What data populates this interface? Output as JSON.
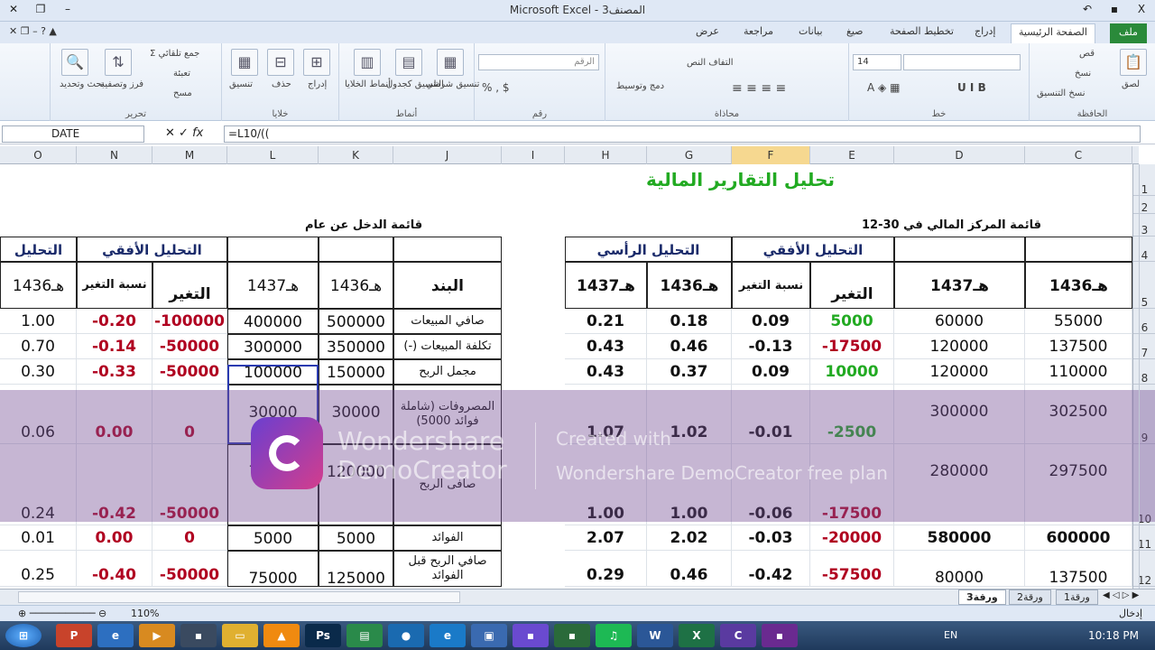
{
  "window": {
    "title": "Microsoft Excel - المصنف3"
  },
  "tabs": [
    "ملف",
    "الصفحة الرئيسية",
    "إدراج",
    "تخطيط الصفحة",
    "صيغ",
    "بيانات",
    "مراجعة",
    "عرض"
  ],
  "ribbon": {
    "clipboard": {
      "group": "الحافظة",
      "paste": "لصق",
      "cut": "قص",
      "copy": "نسخ",
      "format_painter": "نسخ التنسيق"
    },
    "font": {
      "group": "خط",
      "size": "14"
    },
    "alignment": {
      "group": "محاذاة",
      "wrap": "التفاف النص",
      "merge": "دمج وتوسيط"
    },
    "number": {
      "group": "رقم",
      "format": "الرقم"
    },
    "styles": {
      "group": "أنماط",
      "cond": "تنسيق شرطي",
      "table": "التنسيق كجدول",
      "cell": "أنماط الخلايا"
    },
    "cells": {
      "group": "خلايا",
      "insert": "إدراج",
      "delete": "حذف",
      "format": "تنسيق"
    },
    "editing": {
      "group": "تحرير",
      "autosum": "جمع تلقائي",
      "fill": "تعبئة",
      "clear": "مسح",
      "sort": "فرز وتصفية",
      "find": "بحث وتحديد"
    }
  },
  "formula_bar": {
    "name_box": "DATE",
    "formula": "=L10/(("
  },
  "columns": [
    "O",
    "N",
    "M",
    "L",
    "K",
    "J",
    "I",
    "H",
    "G",
    "F",
    "E",
    "D",
    "C"
  ],
  "rows": [
    "1",
    "2",
    "3",
    "4",
    "5",
    "6",
    "7",
    "8",
    "9",
    "10",
    "11",
    "12"
  ],
  "sheet": {
    "title": "تحليل التقارير المالية",
    "left_heading": "قائمة الدخل عن عام",
    "right_heading": "قائمة المركز المالي في 30-12",
    "horiz": "التحليل الأفقي",
    "vert": "التحليل الرأسي",
    "tahlil": "التحليل",
    "change": "التغير",
    "pct_change": "نسبة التغير",
    "y1436": "1436هـ",
    "y1437": "1437هـ",
    "item": "البند",
    "items": [
      "صافي المبيعات",
      "(-) تكلفة المبيعات",
      "مجمل الربح",
      "المصروفات (شاملة فوائد 5000)",
      "صافى الربح",
      "الفوائد",
      "صافي الربح قبل الفوائد"
    ],
    "O": [
      "1.00",
      "0.70",
      "0.30",
      "0.06",
      "0.24",
      "0.01",
      "0.25"
    ],
    "N": [
      "-0.20",
      "-0.14",
      "-0.33",
      "0.00",
      "-0.42",
      "0.00",
      "-0.40"
    ],
    "M": [
      "-100000",
      "-50000",
      "-50000",
      "0",
      "-50000",
      "0",
      "-50000"
    ],
    "L": [
      "400000",
      "300000",
      "100000",
      "30000",
      "70000",
      "5000",
      "75000"
    ],
    "K": [
      "500000",
      "350000",
      "150000",
      "30000",
      "120000",
      "5000",
      "125000"
    ],
    "H": [
      "0.21",
      "0.43",
      "0.43",
      "1.07",
      "1.00",
      "2.07",
      "0.29"
    ],
    "G": [
      "0.18",
      "0.46",
      "0.37",
      "1.02",
      "1.00",
      "2.02",
      "0.46"
    ],
    "F": [
      "0.09",
      "-0.13",
      "0.09",
      "-0.01",
      "-0.06",
      "-0.03",
      "-0.42"
    ],
    "E": [
      "5000",
      "-17500",
      "10000",
      "-2500",
      "-17500",
      "-20000",
      "-57500"
    ],
    "D": [
      "60000",
      "120000",
      "120000",
      "300000",
      "280000",
      "580000",
      "80000"
    ],
    "C": [
      "55000",
      "137500",
      "110000",
      "302500",
      "297500",
      "600000",
      "137500"
    ]
  },
  "watermark": {
    "brand1": "Wondershare",
    "brand2": "DemoCreator",
    "line1": "Created with",
    "line2": "Wondershare DemoCreator free plan"
  },
  "sheet_tabs": [
    "ورقة3",
    "ورقة2",
    "ورقة1"
  ],
  "status": {
    "mode": "إدخال",
    "zoom": "110%"
  },
  "taskbar": {
    "lang": "EN",
    "time": "10:18 PM"
  }
}
